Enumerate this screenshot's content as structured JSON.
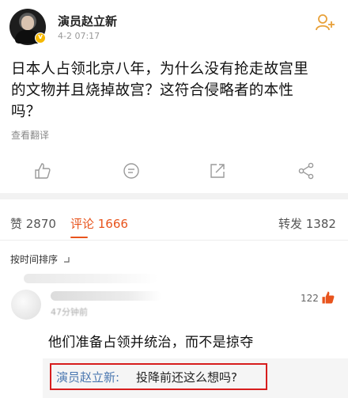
{
  "post": {
    "author": "演员赵立新",
    "time": "4-2 07:17",
    "body_line1": "日本人占领北京八年，为什么没有抢走故宫里",
    "body_line2": "的文物并且烧掉故宫？这符合侵略者的本性",
    "body_line3": "吗？",
    "translate_label": "查看翻译"
  },
  "header": {
    "follow_icon": "add-user-icon",
    "verified_icon": "verified-badge-icon"
  },
  "actions": {
    "items": [
      {
        "icon": "thumbs-up-icon"
      },
      {
        "icon": "comment-icon"
      },
      {
        "icon": "share-icon"
      },
      {
        "icon": "network-share-icon"
      }
    ]
  },
  "tabs": {
    "likes_label": "赞 2870",
    "comments_label": "评论 1666",
    "reposts_label": "转发 1382"
  },
  "sort": {
    "label": "按时间排序"
  },
  "comment": {
    "time": "47分钟前",
    "likes": "122",
    "text": "他们准备占领并统治，而不是掠夺"
  },
  "reply": {
    "author": "演员赵立新:",
    "text": "投降前还这么想吗?"
  },
  "colors": {
    "accent": "#e8541d",
    "link": "#4a77b0",
    "highlight_border": "#d71d1d",
    "verified": "#f5b800"
  }
}
